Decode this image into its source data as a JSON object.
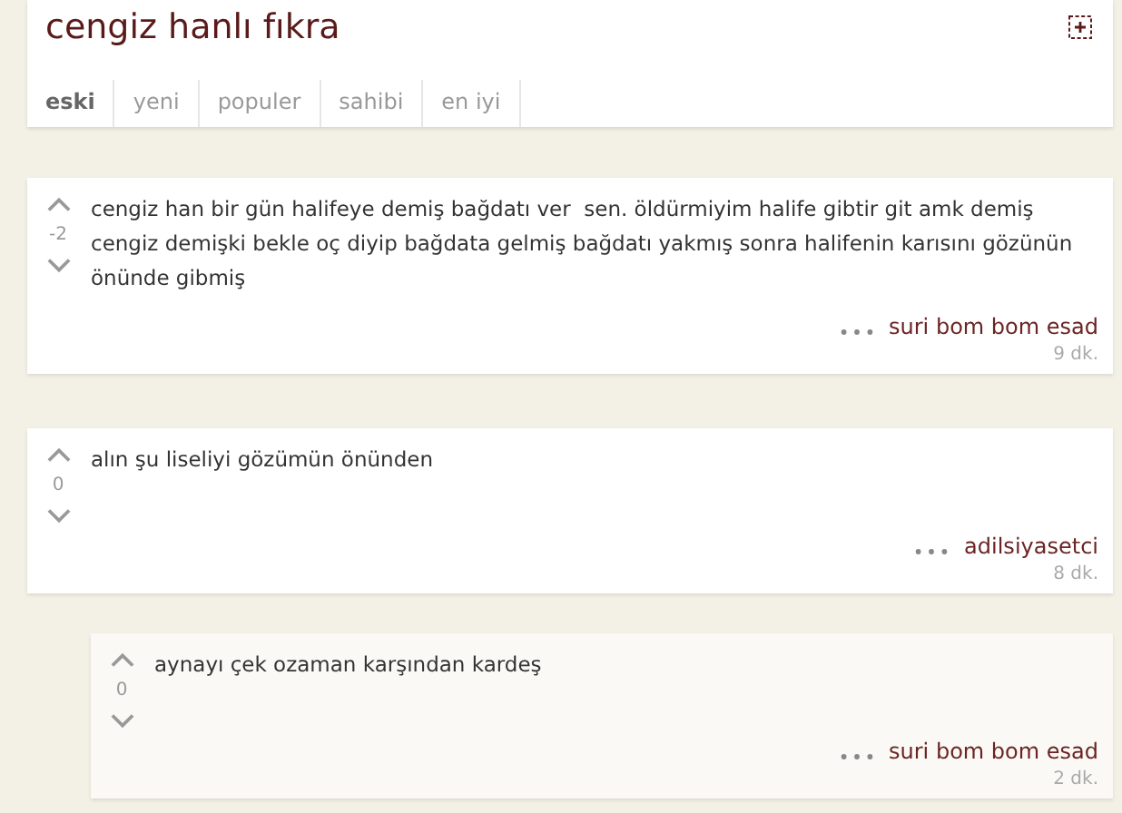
{
  "title": "cengiz hanlı fıkra",
  "tabs": [
    {
      "label": "eski",
      "selected": true
    },
    {
      "label": "yeni",
      "selected": false
    },
    {
      "label": "populer",
      "selected": false
    },
    {
      "label": "sahibi",
      "selected": false
    },
    {
      "label": "en iyi",
      "selected": false
    }
  ],
  "comments": [
    {
      "score": "-2",
      "text": "cengiz han bir gün halifeye demiş bağdatı ver  sen. öldürmiyim halife gibtir git amk demiş cengiz demişki bekle oç diyip bağdata gelmiş bağdatı yakmış sonra halifenin karısını gözünün önünde gibmiş",
      "author": "suri bom bom esad",
      "time": "9 dk."
    },
    {
      "score": "0",
      "text": "alın şu liseliyi gözümün önünden",
      "author": "adilsiyasetci",
      "time": "8 dk.",
      "children": [
        {
          "score": "0",
          "text": "aynayı çek ozaman karşından kardeş",
          "author": "suri bom bom esad",
          "time": "2 dk."
        }
      ]
    }
  ]
}
